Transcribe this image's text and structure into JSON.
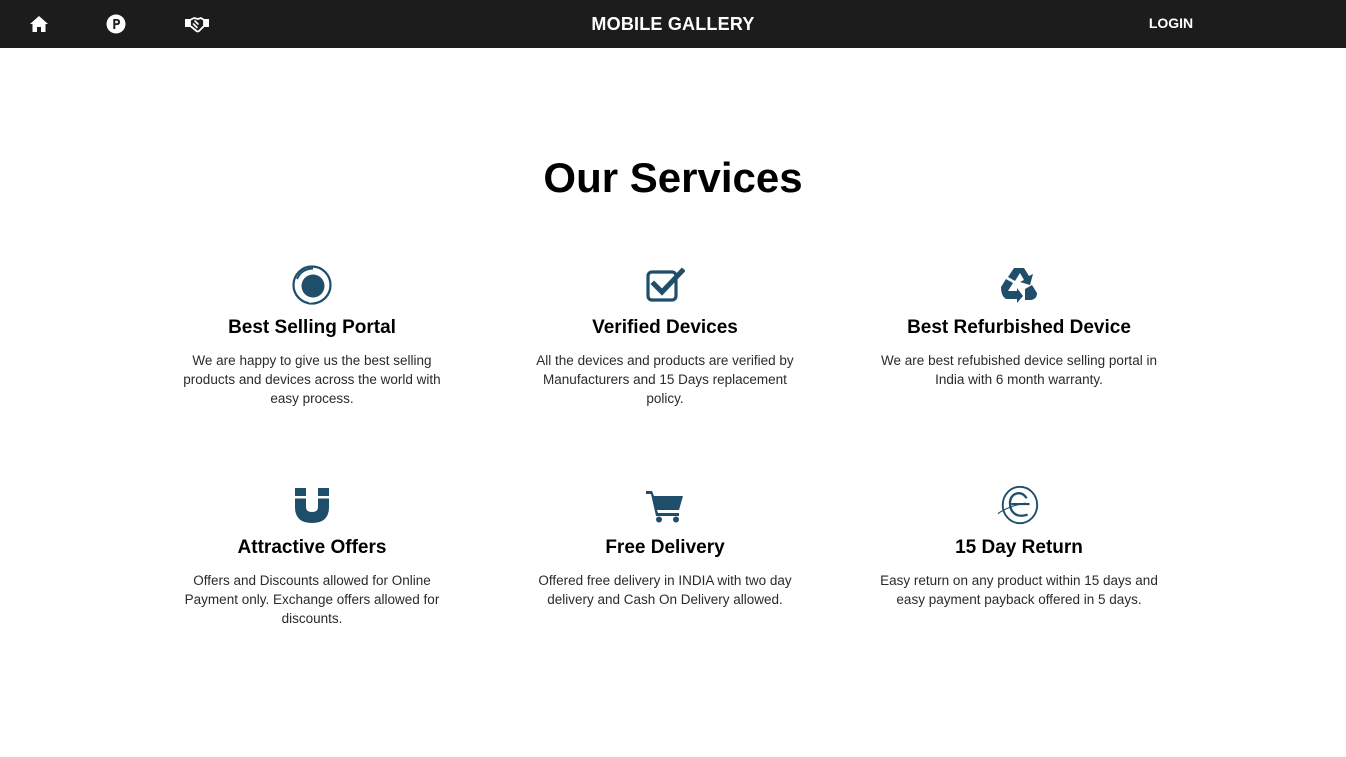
{
  "nav": {
    "brand": "MOBILE GALLERY",
    "login": "LOGIN",
    "icons": [
      "home-icon",
      "parking-icon",
      "handshake-icon"
    ]
  },
  "services": {
    "title": "Our Services",
    "items": [
      {
        "icon": "spiral-eye-icon",
        "heading": "Best Selling Portal",
        "description": "We are happy to give us the best selling products and devices across the world with easy process."
      },
      {
        "icon": "checkbox-check-icon",
        "heading": "Verified Devices",
        "description": "All the devices and products are verified by Manufacturers and 15 Days replacement policy."
      },
      {
        "icon": "recycle-icon",
        "heading": "Best Refurbished Device",
        "description": "We are best refubished device selling portal in India with 6 month warranty."
      },
      {
        "icon": "magnet-icon",
        "heading": "Attractive Offers",
        "description": "Offers and Discounts allowed for Online Payment only. Exchange offers allowed for discounts."
      },
      {
        "icon": "cart-icon",
        "heading": "Free Delivery",
        "description": "Offered free delivery in INDIA with two day delivery and Cash On Delivery allowed."
      },
      {
        "icon": "edge-swirl-icon",
        "heading": "15 Day Return",
        "description": "Easy return on any product within 15 days and easy payment payback offered in 5 days."
      }
    ]
  },
  "colors": {
    "navbar": "#1c1c1c",
    "icon_accent": "#1f4e6b"
  }
}
